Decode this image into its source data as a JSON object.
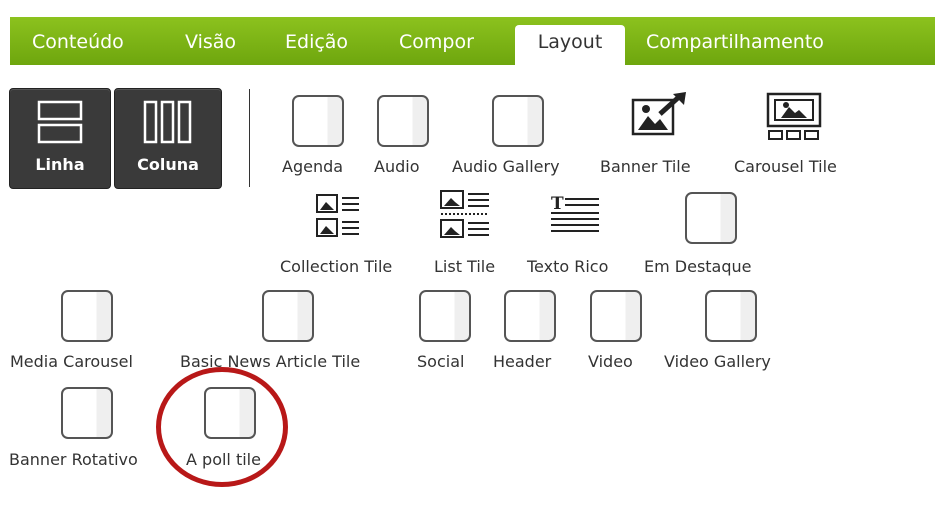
{
  "tabs": [
    {
      "label": "Conteúdo"
    },
    {
      "label": "Visão"
    },
    {
      "label": "Edição"
    },
    {
      "label": "Compor"
    },
    {
      "label": "Layout"
    },
    {
      "label": "Compartilhamento"
    }
  ],
  "layout_buttons": {
    "row": "Linha",
    "column": "Coluna"
  },
  "tiles": {
    "agenda": "Agenda",
    "audio": "Audio",
    "audio_gallery": "Audio Gallery",
    "banner_tile": "Banner Tile",
    "carousel_tile": "Carousel Tile",
    "collection_tile": "Collection Tile",
    "list_tile": "List Tile",
    "texto_rico": "Texto Rico",
    "em_destaque": "Em Destaque",
    "media_carousel": "Media Carousel",
    "basic_news": "Basic News Article Tile",
    "social": "Social",
    "header": "Header",
    "video": "Video",
    "video_gallery": "Video Gallery",
    "banner_rotativo": "Banner Rotativo",
    "poll_tile": "A poll tile"
  },
  "colors": {
    "tab_bar": "#7ab317",
    "button_dark": "#3a3a3a",
    "highlight_circle": "#b81818"
  }
}
